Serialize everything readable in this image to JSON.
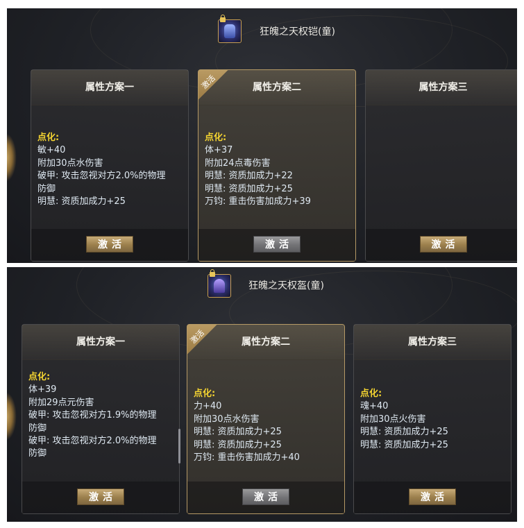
{
  "panels": [
    {
      "item_name": "狂魄之天权铠(童)",
      "item_icon": "armor-chest-icon",
      "cards": [
        {
          "title": "属性方案一",
          "active": false,
          "lines": [
            {
              "text": "点化:",
              "kind": "header"
            },
            {
              "text": "敏+40",
              "kind": "attr"
            },
            {
              "text": "附加30点水伤害",
              "kind": "attr"
            },
            {
              "text": "破甲: 攻击忽视对方2.0%的物理",
              "kind": "attr"
            },
            {
              "text": "防御",
              "kind": "attr"
            },
            {
              "text": "明慧: 资质加成力+25",
              "kind": "attr"
            }
          ],
          "button": "激活"
        },
        {
          "title": "属性方案二",
          "active": true,
          "badge": "激活",
          "lines": [
            {
              "text": "点化:",
              "kind": "header"
            },
            {
              "text": "体+37",
              "kind": "attr"
            },
            {
              "text": "附加24点毒伤害",
              "kind": "attr"
            },
            {
              "text": "明慧: 资质加成力+22",
              "kind": "attr"
            },
            {
              "text": "明慧: 资质加成力+25",
              "kind": "attr"
            },
            {
              "text": "万钧: 重击伤害加成力+39",
              "kind": "attr"
            }
          ],
          "button": "激活"
        },
        {
          "title": "属性方案三",
          "active": false,
          "lines": [],
          "button": "激活"
        }
      ]
    },
    {
      "item_name": "狂魄之天权盔(童)",
      "item_icon": "helmet-icon",
      "cards": [
        {
          "title": "属性方案一",
          "active": false,
          "lines": [
            {
              "text": "点化:",
              "kind": "header"
            },
            {
              "text": "体+39",
              "kind": "attr"
            },
            {
              "text": "附加29点元伤害",
              "kind": "attr"
            },
            {
              "text": "破甲: 攻击忽视对方1.9%的物理",
              "kind": "attr"
            },
            {
              "text": "防御",
              "kind": "attr"
            },
            {
              "text": "破甲: 攻击忽视对方2.0%的物理",
              "kind": "attr"
            },
            {
              "text": "防御",
              "kind": "attr"
            }
          ],
          "button": "激活"
        },
        {
          "title": "属性方案二",
          "active": true,
          "badge": "激活",
          "lines": [
            {
              "text": "点化:",
              "kind": "header"
            },
            {
              "text": "力+40",
              "kind": "attr"
            },
            {
              "text": "附加30点水伤害",
              "kind": "attr"
            },
            {
              "text": "明慧: 资质加成力+25",
              "kind": "attr"
            },
            {
              "text": "明慧: 资质加成力+25",
              "kind": "attr"
            },
            {
              "text": "万钧: 重击伤害加成力+40",
              "kind": "attr"
            }
          ],
          "button": "激活"
        },
        {
          "title": "属性方案三",
          "active": false,
          "lines": [
            {
              "text": "点化:",
              "kind": "header"
            },
            {
              "text": "魂+40",
              "kind": "attr"
            },
            {
              "text": "附加30点火伤害",
              "kind": "attr"
            },
            {
              "text": "明慧: 资质加成力+25",
              "kind": "attr"
            },
            {
              "text": "明慧: 资质加成力+25",
              "kind": "attr"
            }
          ],
          "button": "激活"
        }
      ]
    }
  ],
  "colors": {
    "header_yellow": "#f5d531",
    "attr_text": "#dfe9f2",
    "button_gold": "#b09260",
    "button_gray": "#808083",
    "active_border": "#b69a66"
  }
}
